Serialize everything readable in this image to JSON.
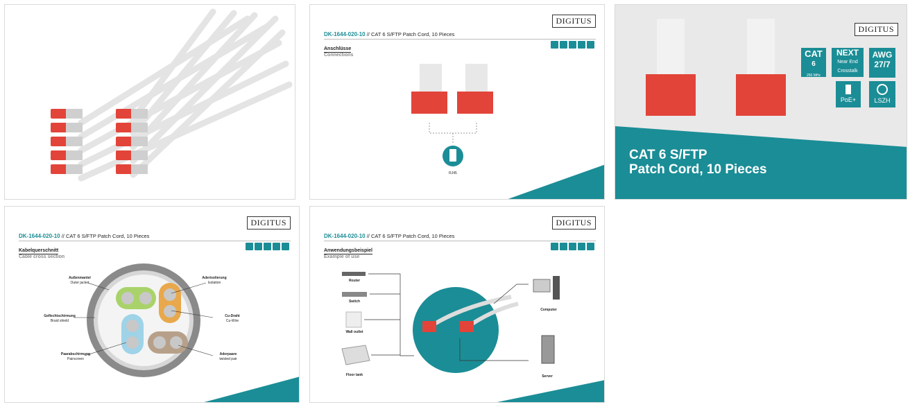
{
  "brand": {
    "logo": "DIGITUS",
    "accent": "#1b8d96",
    "plug_color": "#e2443a"
  },
  "product": {
    "code": "DK-1644-020-10",
    "separator": "//",
    "title": "CAT 6 S/FTP Patch Cord, 10 Pieces"
  },
  "tile2": {
    "section_de": "Anschlüsse",
    "section_en": "Connections",
    "connector_label": "RJ45"
  },
  "tile3": {
    "hero_line1": "CAT 6 S/FTP",
    "hero_line2": "Patch Cord, 10 Pieces",
    "badges": [
      {
        "top": "CAT",
        "mid": "6",
        "sub": "250 MHz"
      },
      {
        "top": "NEXT",
        "mid": "Near End",
        "sub": "Crosstalk"
      },
      {
        "top": "AWG",
        "mid": "27/7",
        "sub": ""
      },
      {
        "top": "",
        "mid": "",
        "sub": "PoE+"
      },
      {
        "top": "",
        "mid": "",
        "sub": "LSZH"
      }
    ]
  },
  "tile4": {
    "section_de": "Kabelquerschnitt",
    "section_en": "Cable cross section",
    "labels": [
      {
        "de": "Außenmantel",
        "en": "Outer jacket"
      },
      {
        "de": "Aderisolierung",
        "en": "Isolation"
      },
      {
        "de": "Geflechtschirmung",
        "en": "Braid shield"
      },
      {
        "de": "Cu-Draht",
        "en": "Cu-Wire"
      },
      {
        "de": "Paarabschirmung",
        "en": "Pairscreen"
      },
      {
        "de": "Aderpaare",
        "en": "twisted pair"
      }
    ]
  },
  "tile5": {
    "section_de": "Anwendungsbeispiel",
    "section_en": "Example of use",
    "devices": [
      "Router",
      "Switch",
      "Wall outlet",
      "Floor tank",
      "Computer",
      "Server"
    ]
  }
}
